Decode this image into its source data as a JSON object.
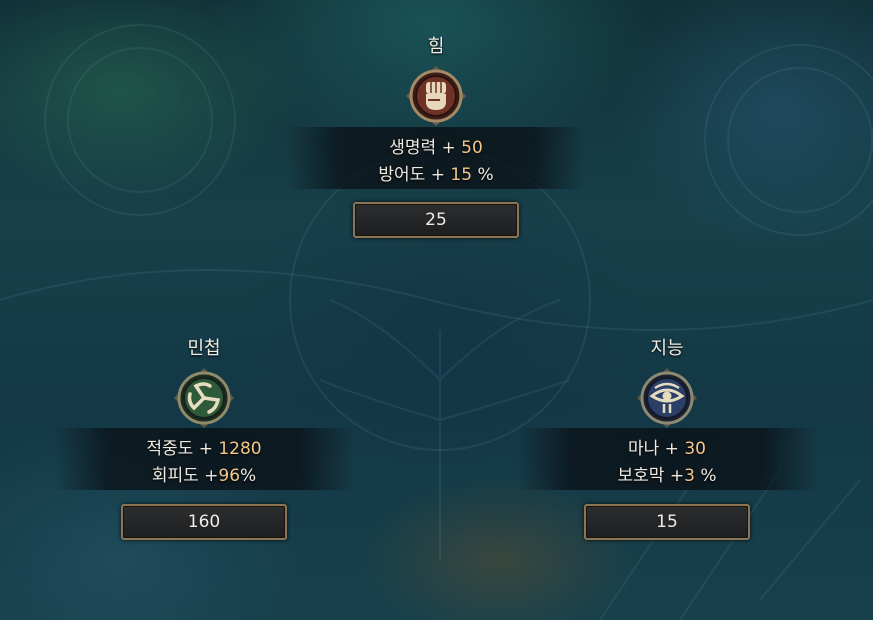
{
  "attributes": [
    {
      "key": "strength",
      "title": "힘",
      "icon": "fist-icon",
      "ring_color": "#7a3b2a",
      "stats": [
        {
          "name": "생명력",
          "value": "50",
          "suffix": ""
        },
        {
          "name": "방어도",
          "value": "15",
          "suffix": "%"
        }
      ],
      "points": "25"
    },
    {
      "key": "agility",
      "title": "민첩",
      "icon": "triskelion-icon",
      "ring_color": "#2f5a3a",
      "stats": [
        {
          "name": "적중도",
          "value": "1280",
          "suffix": ""
        },
        {
          "name": "회피도",
          "value": "96",
          "suffix": "%"
        }
      ],
      "points": "160"
    },
    {
      "key": "intelligence",
      "title": "지능",
      "icon": "eye-icon",
      "ring_color": "#2c3f66",
      "stats": [
        {
          "name": "마나",
          "value": "30",
          "suffix": ""
        },
        {
          "name": "보호막",
          "value": "3",
          "suffix": "%"
        }
      ],
      "points": "15"
    }
  ],
  "colors": {
    "stat_value": "#f3c789",
    "frame_gold": "#8a7652"
  }
}
